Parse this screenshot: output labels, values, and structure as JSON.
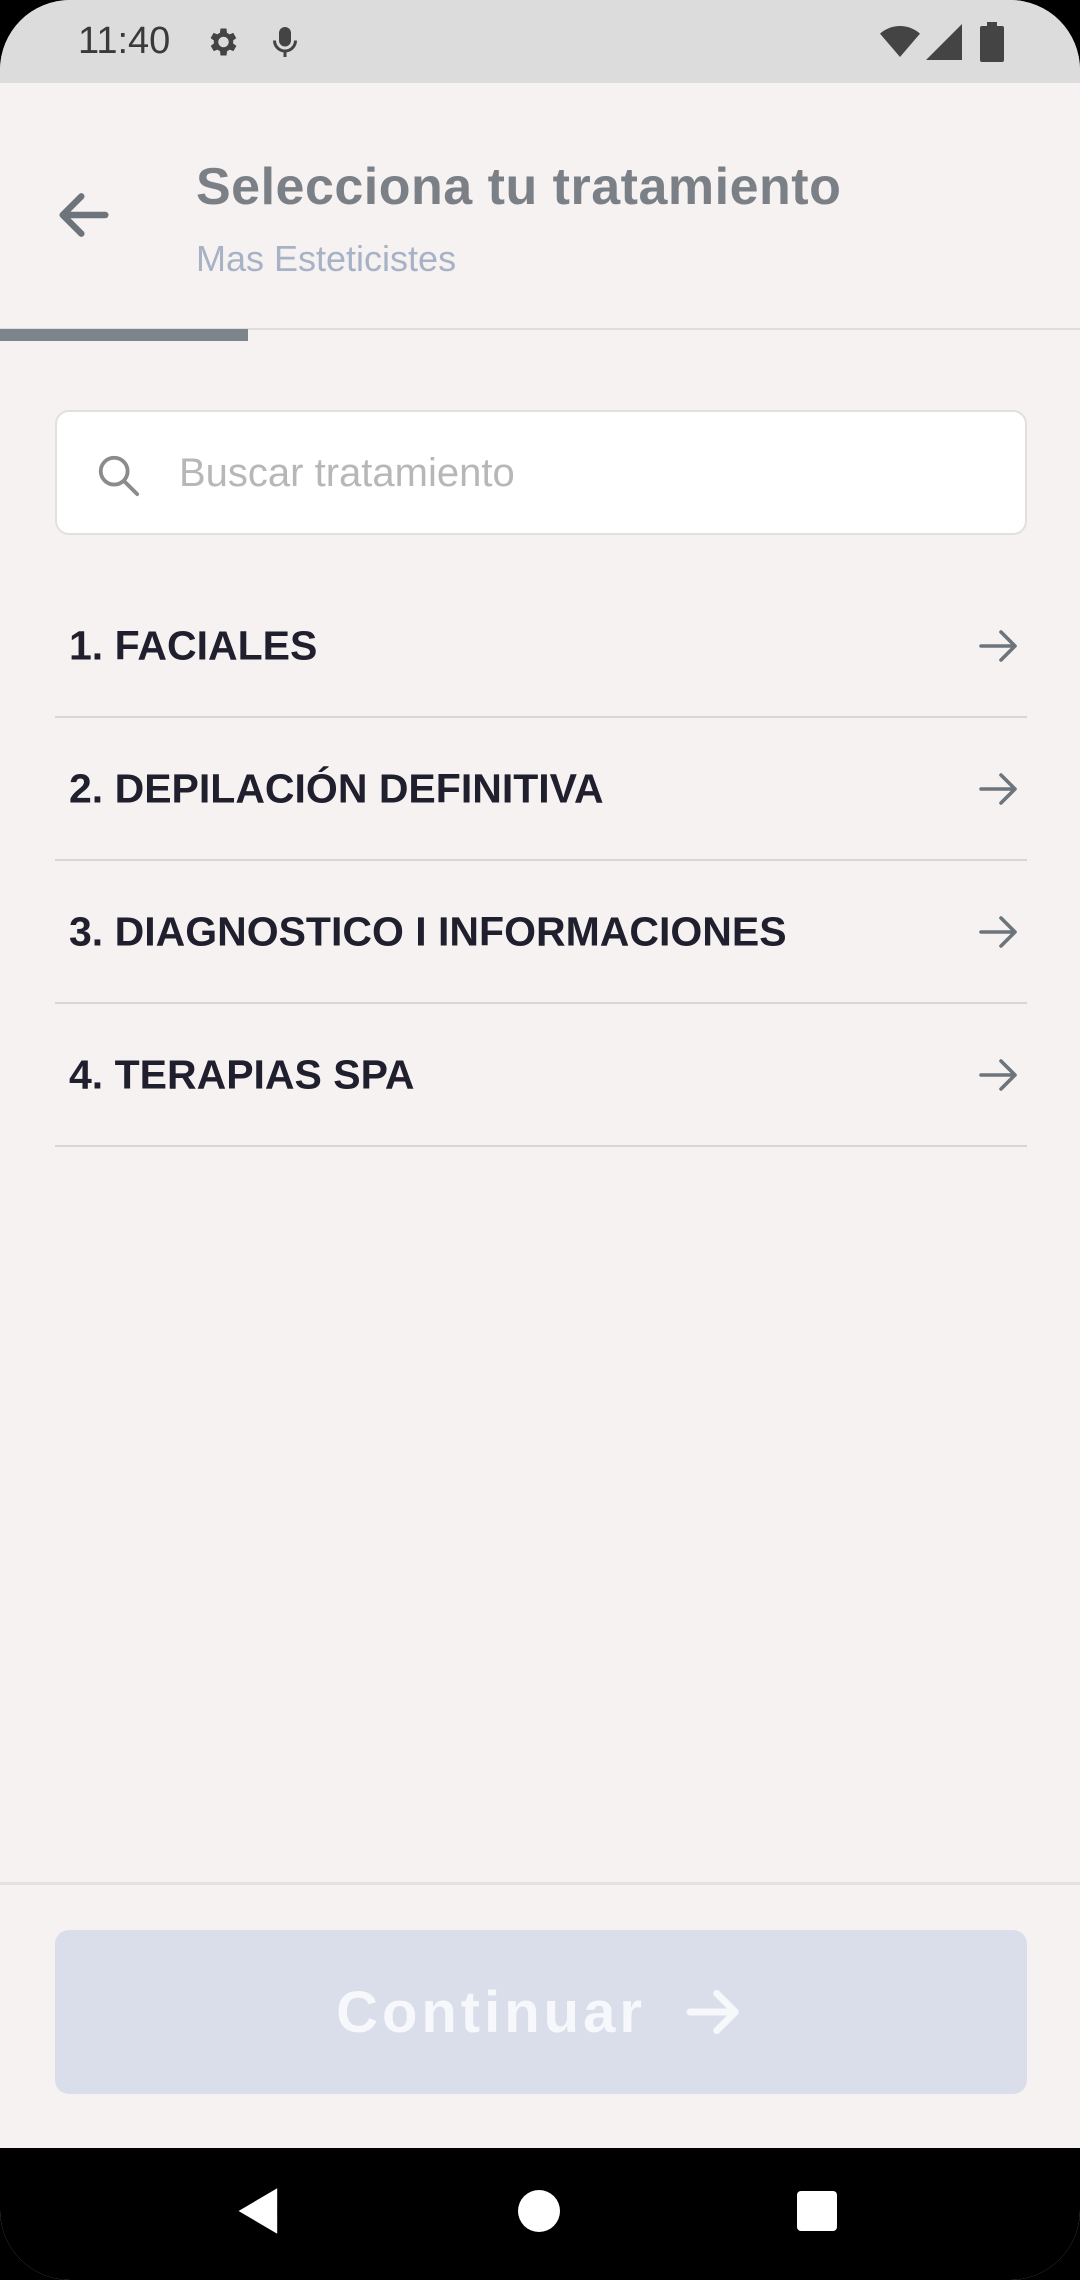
{
  "status_bar": {
    "time": "11:40",
    "icons": [
      "gear-icon",
      "mic-icon",
      "wifi-icon",
      "signal-icon",
      "battery-icon"
    ]
  },
  "header": {
    "title": "Selecciona tu tratamiento",
    "subtitle": "Mas Esteticistes",
    "progress": 0.23
  },
  "search": {
    "placeholder": "Buscar tratamiento",
    "value": ""
  },
  "list": {
    "items": [
      {
        "label": "1. FACIALES"
      },
      {
        "label": "2. DEPILACIÓN DEFINITIVA"
      },
      {
        "label": "3. DIAGNOSTICO I INFORMACIONES"
      },
      {
        "label": "4. TERAPIAS SPA"
      }
    ]
  },
  "footer": {
    "continue_label": "Continuar"
  },
  "colors": {
    "background": "#f6f2f1",
    "title": "#7b8087",
    "subtitle": "#a8b2c6",
    "button_disabled": "#d9deea",
    "progress": "#7d858c"
  }
}
